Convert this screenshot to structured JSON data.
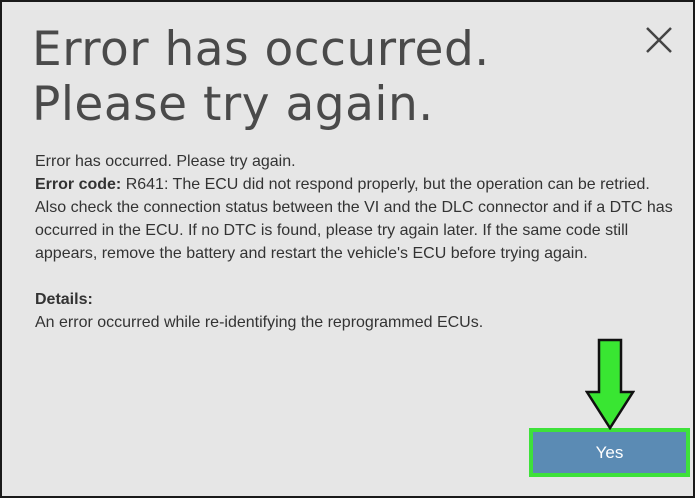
{
  "dialog": {
    "title_line1": "Error has occurred.",
    "title_line2": "Please try again.",
    "message": "Error has occurred. Please try again.",
    "error_code_label": "Error code:",
    "error_code_text": " R641: The ECU did not respond properly, but the operation can be retried. Also check the connection status between the VI and the DLC connector and if a DTC has occurred in the ECU. If no DTC is found, please try again later. If the same code still appears, remove the battery and restart the vehicle's ECU before trying again.",
    "details_label": "Details:",
    "details_text": "An error occurred while re-identifying the reprogrammed ECUs.",
    "yes_label": "Yes",
    "close_icon": "close-icon"
  },
  "annotation": {
    "arrow_icon": "arrow-down-icon",
    "arrow_color": "#39e632",
    "highlight_color": "#3ee13a"
  },
  "colors": {
    "dialog_bg": "#e6e6e6",
    "button_bg": "#5b8bb4"
  }
}
